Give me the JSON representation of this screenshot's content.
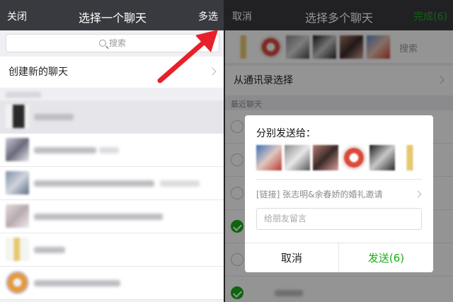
{
  "left": {
    "header": {
      "close_label": "关闭",
      "title": "选择一个聊天",
      "multi_select_label": "多选"
    },
    "search": {
      "placeholder": "搜索"
    },
    "new_chat_label": "创建新的聊天"
  },
  "right": {
    "header": {
      "cancel_label": "取消",
      "title": "选择多个聊天",
      "done_label": "完成(6)"
    },
    "search_placeholder": "搜索",
    "from_contacts_label": "从通讯录选择",
    "recent_label": "最近聊天"
  },
  "dialog": {
    "title": "分别发送给：",
    "link_text": "[链接] 张志明&余春娇的婚礼邀请",
    "message_placeholder": "给朋友留言",
    "cancel_label": "取消",
    "send_label": "发送(6)"
  },
  "colors": {
    "accent_green": "#1aad19",
    "header_bg": "#393a3f",
    "arrow_red": "#e8202a"
  }
}
